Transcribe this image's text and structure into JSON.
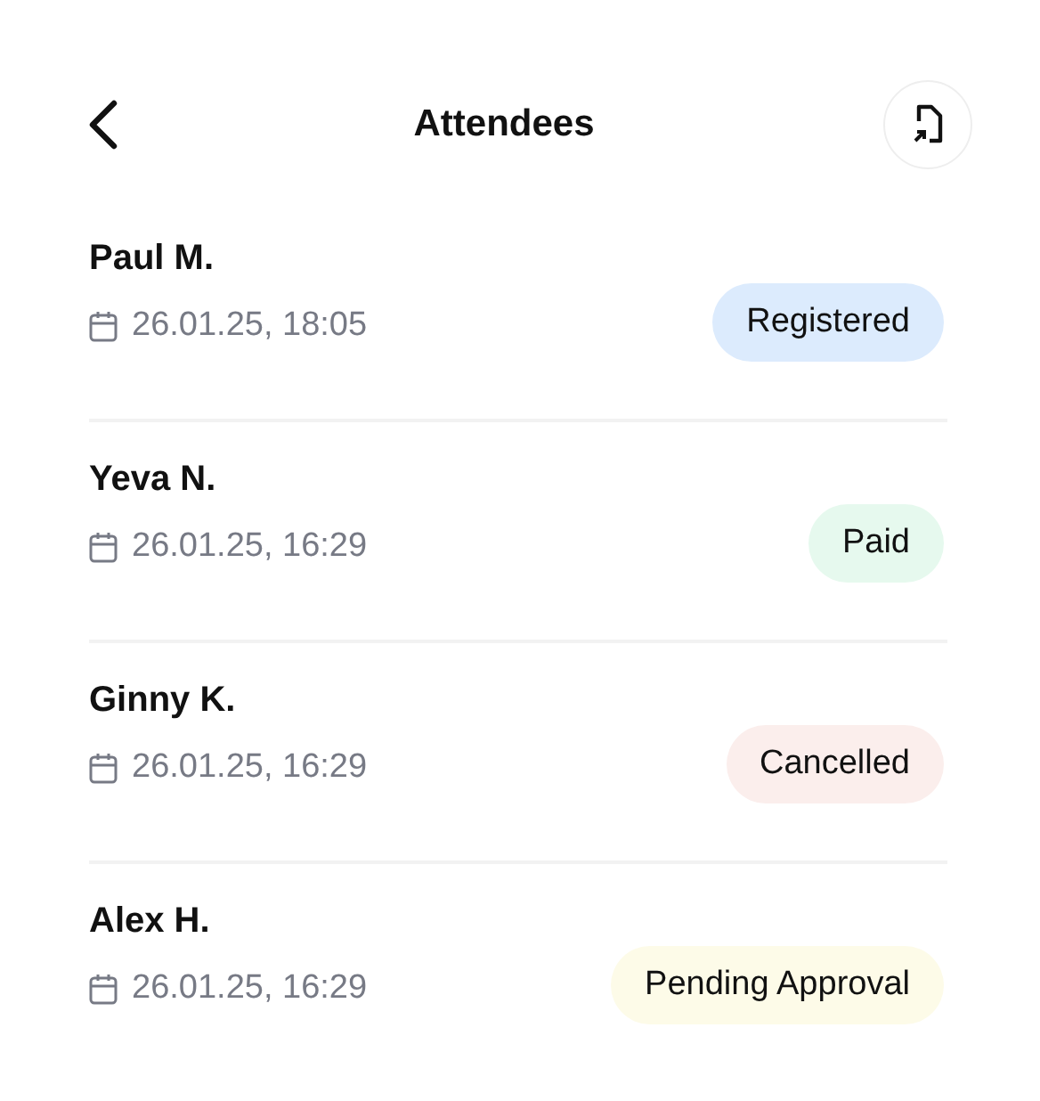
{
  "header": {
    "title": "Attendees"
  },
  "attendees": [
    {
      "name": "Paul M.",
      "date": "26.01.25, 18:05",
      "status": "Registered",
      "color": "#dcebfd"
    },
    {
      "name": "Yeva N.",
      "date": "26.01.25, 16:29",
      "status": "Paid",
      "color": "#e6f9ee"
    },
    {
      "name": "Ginny K.",
      "date": "26.01.25, 16:29",
      "status": "Cancelled",
      "color": "#fbeeec"
    },
    {
      "name": "Alex H.",
      "date": "26.01.25, 16:29",
      "status": "Pending Approval",
      "color": "#fdfbe8"
    }
  ]
}
